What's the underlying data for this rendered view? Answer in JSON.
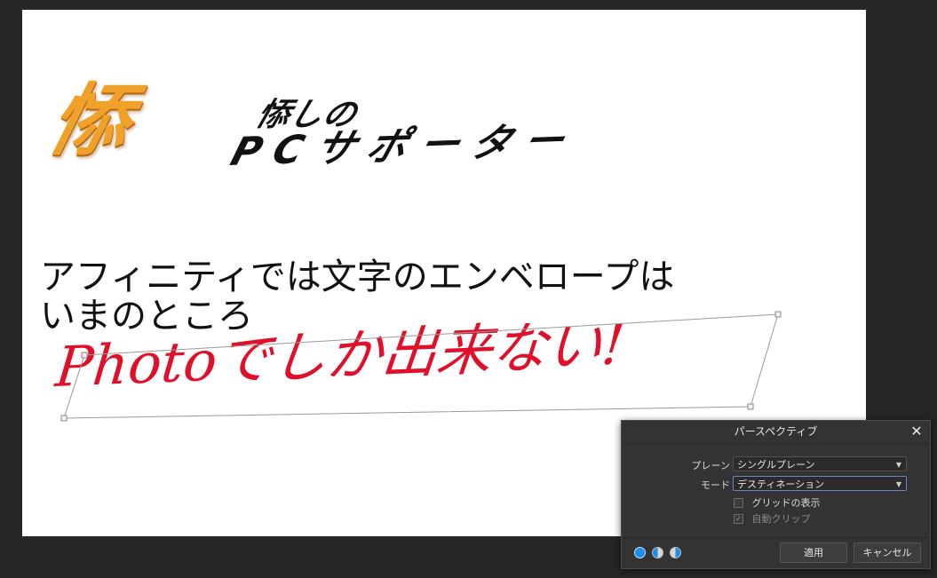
{
  "canvas": {
    "logo_mark": "悿",
    "logo_line1": "悿しの",
    "logo_line2": "PCサポーター",
    "headline_line1": "アフィニティでは文字のエンベロープは",
    "headline_line2": "いまのところ",
    "perspective_text": "Photoでしか出来ない!"
  },
  "dialog": {
    "title": "パースペクティブ",
    "close_glyph": "✕",
    "plane_label": "プレーン",
    "plane_value": "シングルプレーン",
    "mode_label": "モード",
    "mode_value": "デスティネーション",
    "grid_label": "グリッドの表示",
    "auto_clip_label": "自動クリップ",
    "apply_label": "適用",
    "cancel_label": "キャンセル",
    "accent_color": "#1e8ee8"
  }
}
